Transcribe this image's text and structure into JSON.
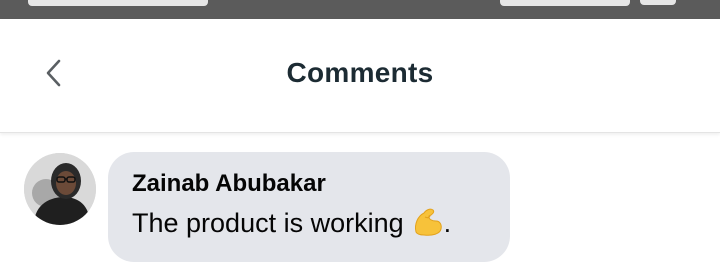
{
  "status_bar": {
    "background": "#5b5b5b"
  },
  "header": {
    "title": "Comments",
    "back_icon": "chevron-left-icon"
  },
  "comments": [
    {
      "author": "Zainab Abubakar",
      "text": "The product is working",
      "emoji": "flexed-biceps-icon",
      "trailing": ".",
      "bubble_color": "#e4e6eb"
    }
  ]
}
